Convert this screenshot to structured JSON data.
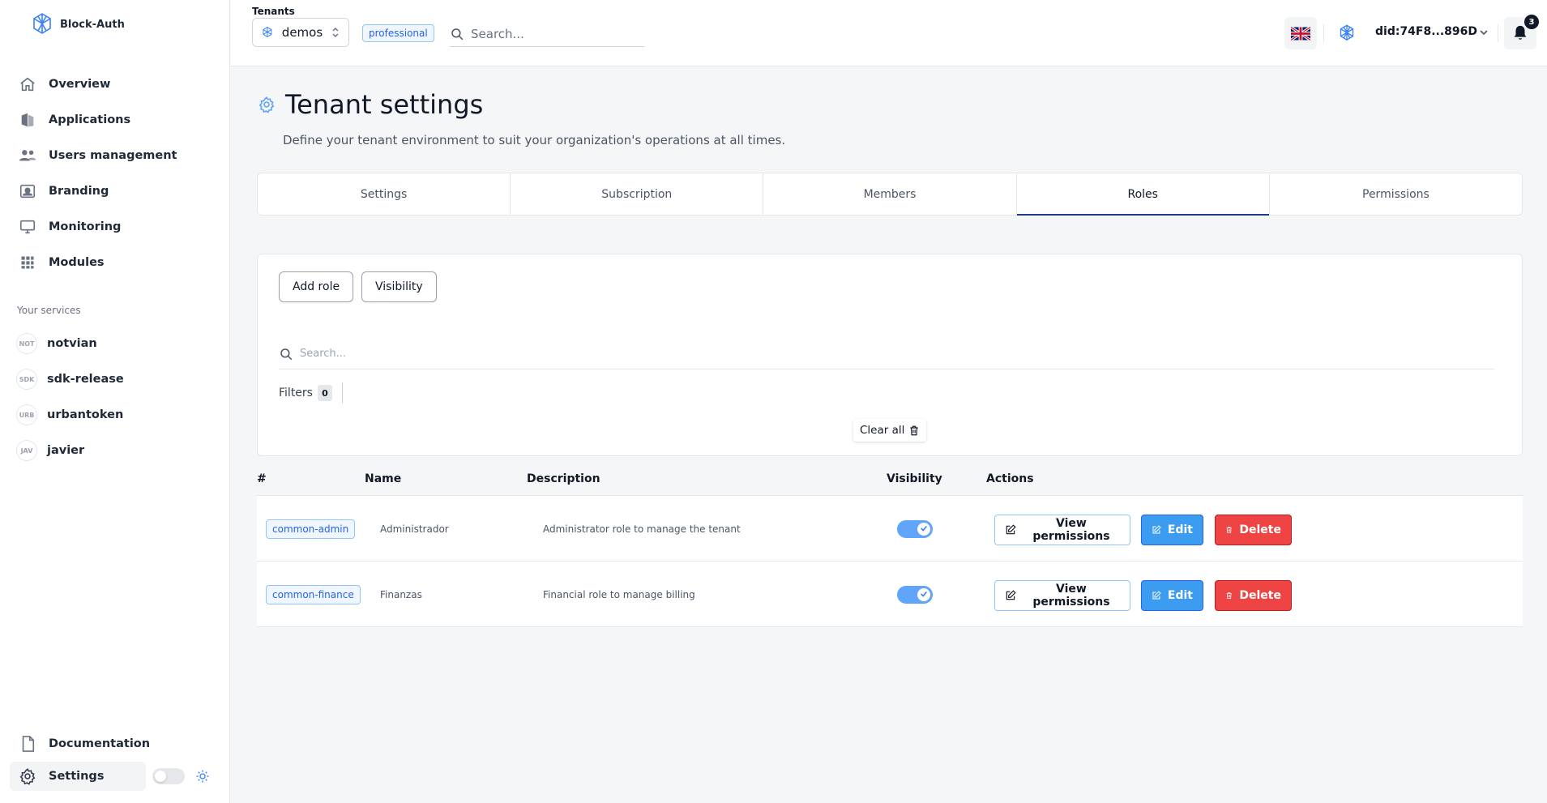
{
  "app": {
    "name": "Block-Auth"
  },
  "sidebar": {
    "nav": [
      {
        "label": "Overview",
        "icon": "home-icon"
      },
      {
        "label": "Applications",
        "icon": "applications-icon"
      },
      {
        "label": "Users management",
        "icon": "users-icon"
      },
      {
        "label": "Branding",
        "icon": "branding-icon"
      },
      {
        "label": "Monitoring",
        "icon": "monitor-icon"
      },
      {
        "label": "Modules",
        "icon": "grid-icon"
      }
    ],
    "services_title": "Your services",
    "services": [
      {
        "abbr": "NOT",
        "label": "notvian"
      },
      {
        "abbr": "SDK",
        "label": "sdk-release"
      },
      {
        "abbr": "URB",
        "label": "urbantoken"
      },
      {
        "abbr": "JAV",
        "label": "javier"
      }
    ],
    "footer": [
      {
        "label": "Documentation",
        "icon": "document-icon"
      },
      {
        "label": "Settings",
        "icon": "gear-icon"
      }
    ]
  },
  "header": {
    "tenants_label": "Tenants",
    "tenant_selected": "demos",
    "plan": "professional",
    "search_placeholder": "Search...",
    "did": "did:74F8...896D",
    "notification_count": "3"
  },
  "page": {
    "title": "Tenant settings",
    "description": "Define your tenant environment to suit your organization's operations at all times."
  },
  "tabs": [
    {
      "label": "Settings"
    },
    {
      "label": "Subscription"
    },
    {
      "label": "Members"
    },
    {
      "label": "Roles",
      "active": true
    },
    {
      "label": "Permissions"
    }
  ],
  "roles_panel": {
    "add_role": "Add role",
    "visibility": "Visibility",
    "search_placeholder": "Search...",
    "filters_label": "Filters",
    "filters_count": "0",
    "clear_all": "Clear all"
  },
  "table": {
    "columns": [
      "#",
      "Name",
      "Description",
      "Visibility",
      "Actions"
    ],
    "rows": [
      {
        "id": "common-admin",
        "name": "Administrador",
        "description": "Administrator role to manage the tenant",
        "visible": true
      },
      {
        "id": "common-finance",
        "name": "Finanzas",
        "description": "Financial role to manage billing",
        "visible": true
      }
    ],
    "actions": {
      "view": "View permissions",
      "edit": "Edit",
      "delete": "Delete"
    }
  },
  "colors": {
    "accent": "#60a5fa",
    "brand": "#3b82f6",
    "danger": "#ef4444",
    "active_tab": "#1e3a8a"
  }
}
